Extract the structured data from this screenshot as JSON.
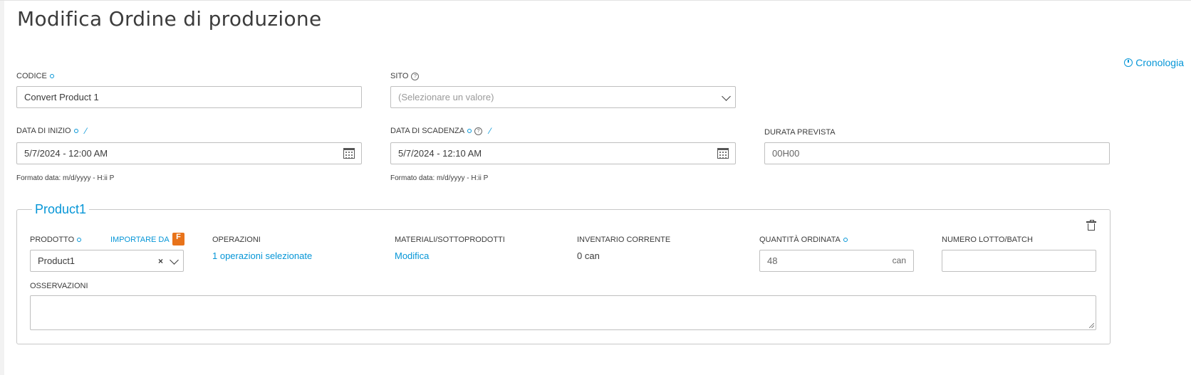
{
  "page": {
    "title": "Modifica Ordine di produzione"
  },
  "history_link": {
    "label": "Cronologia",
    "icon": "clock-icon"
  },
  "fields": {
    "codice": {
      "label": "CODICE",
      "value": "Convert Product 1"
    },
    "sito": {
      "label": "SITO",
      "placeholder": "(Selezionare un valore)"
    },
    "data_inizio": {
      "label": "DATA DI INIZIO",
      "value": "5/7/2024 - 12:00 AM",
      "hint": "Formato data: m/d/yyyy - H:ii P"
    },
    "data_scadenza": {
      "label": "DATA DI SCADENZA",
      "value": "5/7/2024 - 12:10 AM",
      "hint": "Formato data: m/d/yyyy - H:ii P"
    },
    "durata_prevista": {
      "label": "DURATA PREVISTA",
      "value": "00H00"
    }
  },
  "product_section": {
    "legend": "Product1",
    "prodotto": {
      "label": "PRODOTTO",
      "value": "Product1",
      "import_label": "IMPORTARE DA",
      "import_badge": "F"
    },
    "operazioni": {
      "label": "OPERAZIONI",
      "value": "1 operazioni selezionate"
    },
    "materiali": {
      "label": "MATERIALI/SOTTOPRODOTTI",
      "value": "Modifica"
    },
    "inventario": {
      "label": "INVENTARIO CORRENTE",
      "value": "0 can"
    },
    "quantita": {
      "label": "QUANTITÀ ORDINATA",
      "value": "48",
      "unit": "can"
    },
    "lotto": {
      "label": "NUMERO LOTTO/BATCH",
      "value": ""
    },
    "osservazioni": {
      "label": "OSSERVAZIONI",
      "value": ""
    }
  },
  "colors": {
    "accent": "#0696d7",
    "badge": "#e8731a",
    "text": "#3c3c3c",
    "border": "#bfbfbf"
  }
}
